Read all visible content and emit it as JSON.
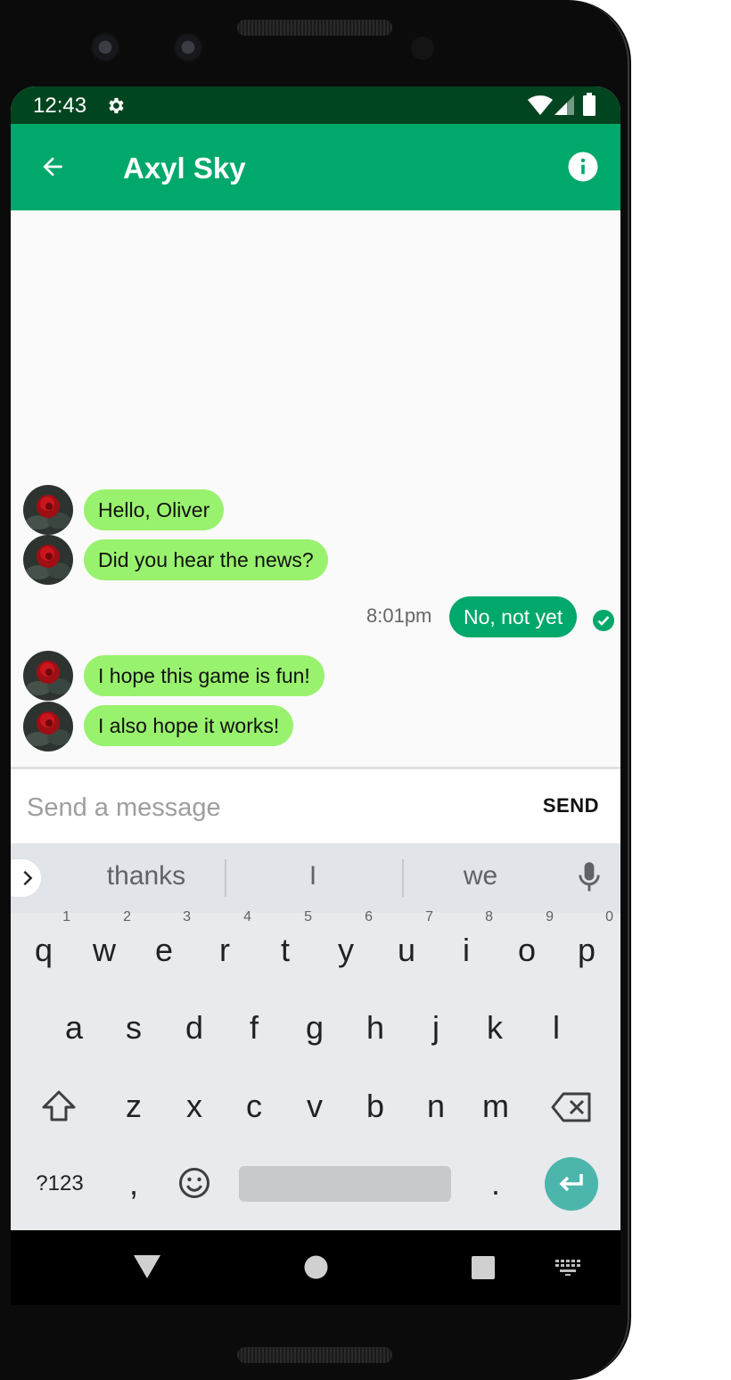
{
  "status_bar": {
    "time": "12:43",
    "icons": [
      "settings-icon",
      "wifi-icon",
      "signal-icon",
      "battery-icon"
    ]
  },
  "app_bar": {
    "title": "Axyl Sky",
    "back_icon": "arrow-back-icon",
    "info_icon": "info-icon"
  },
  "messages": [
    {
      "direction": "incoming",
      "text": "Hello, Oliver"
    },
    {
      "direction": "incoming",
      "text": "Did you hear the news?"
    },
    {
      "direction": "outgoing",
      "text": "No, not yet",
      "time": "8:01pm",
      "status": "read"
    },
    {
      "direction": "incoming",
      "text": "I hope this game is fun!"
    },
    {
      "direction": "incoming",
      "text": "I also hope it works!"
    }
  ],
  "composer": {
    "placeholder": "Send a message",
    "value": "",
    "send_label": "SEND"
  },
  "keyboard": {
    "suggestions": [
      "thanks",
      "I",
      "we"
    ],
    "row1": [
      [
        "q",
        "1"
      ],
      [
        "w",
        "2"
      ],
      [
        "e",
        "3"
      ],
      [
        "r",
        "4"
      ],
      [
        "t",
        "5"
      ],
      [
        "y",
        "6"
      ],
      [
        "u",
        "7"
      ],
      [
        "i",
        "8"
      ],
      [
        "o",
        "9"
      ],
      [
        "p",
        "0"
      ]
    ],
    "row2": [
      "a",
      "s",
      "d",
      "f",
      "g",
      "h",
      "j",
      "k",
      "l"
    ],
    "row3": [
      "z",
      "x",
      "c",
      "v",
      "b",
      "n",
      "m"
    ],
    "symbols_label": "?123",
    "comma": ",",
    "period": "."
  },
  "colors": {
    "primary": "#00a86b",
    "status_bar": "#00451f",
    "incoming_bubble": "#99f26e",
    "enter_key": "#4db6ac"
  }
}
